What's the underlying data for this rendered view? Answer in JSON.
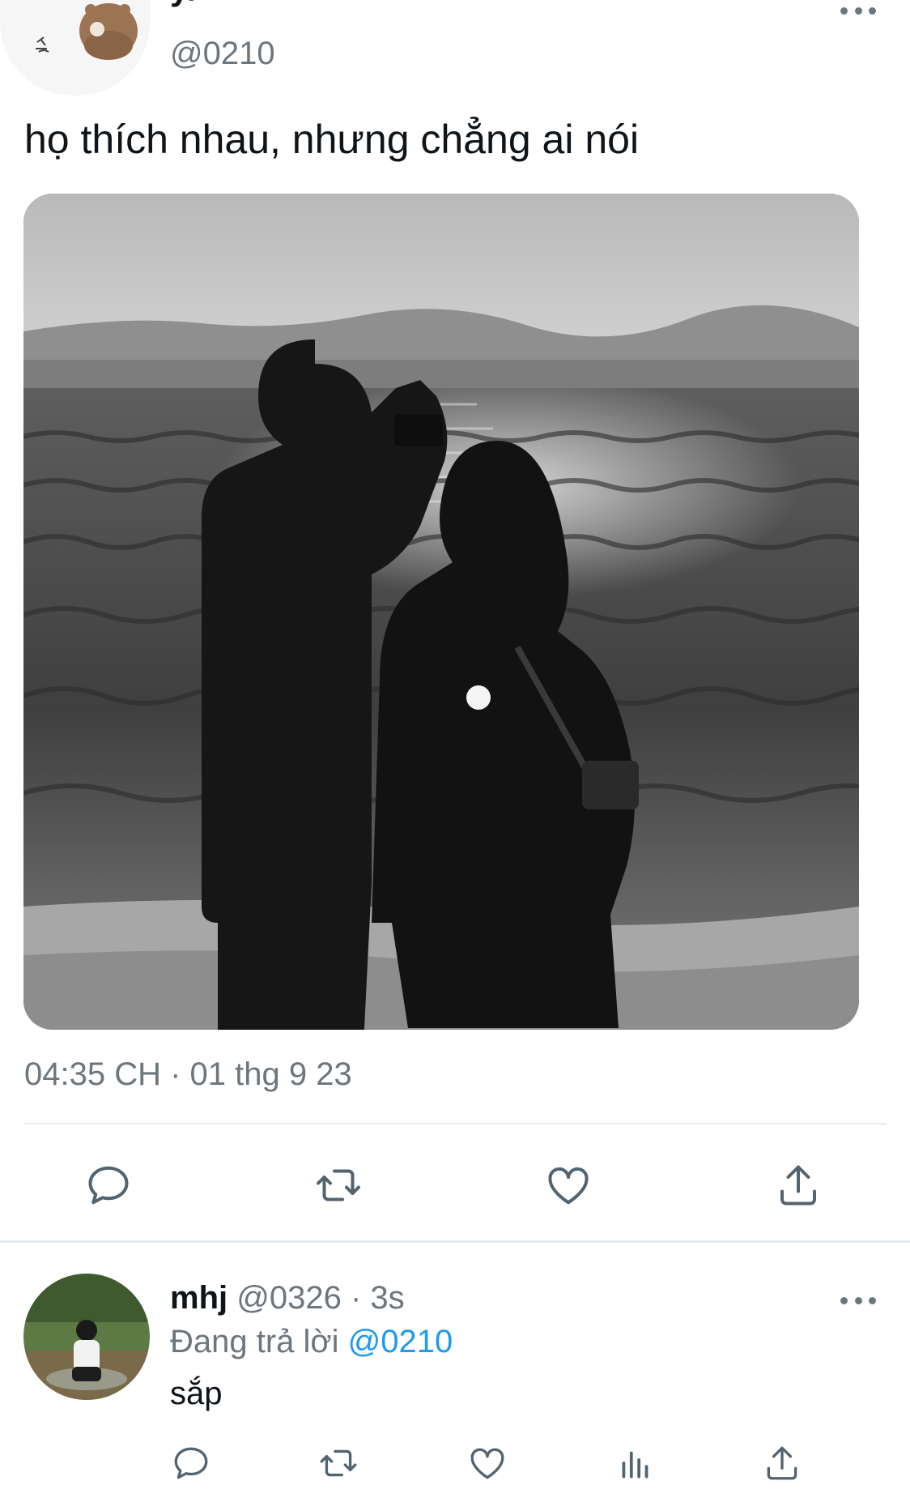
{
  "tweet": {
    "author_name": "y/n",
    "author_handle": "@0210",
    "text": "họ thích nhau, nhưng chẳng ai nói",
    "timestamp": "04:35 CH · 01 thg 9 23",
    "image_description": "black-and-white photo of a couple facing the sea",
    "actions": [
      "reply-icon",
      "retweet-icon",
      "like-icon",
      "share-icon"
    ]
  },
  "reply": {
    "author_name": "mhj",
    "author_handle": "@0326",
    "time": "3s",
    "separator": " · ",
    "replying_to_label": "Đang trả lời",
    "replying_to_handle": "@0210",
    "text": "sắp",
    "actions": [
      "reply-icon",
      "retweet-icon",
      "like-icon",
      "analytics-icon",
      "share-icon"
    ]
  },
  "colors": {
    "text_primary": "#0f1419",
    "text_secondary": "#6e767d",
    "link": "#1d9bf0",
    "divider": "#e6ecf0",
    "icon": "#536471"
  }
}
